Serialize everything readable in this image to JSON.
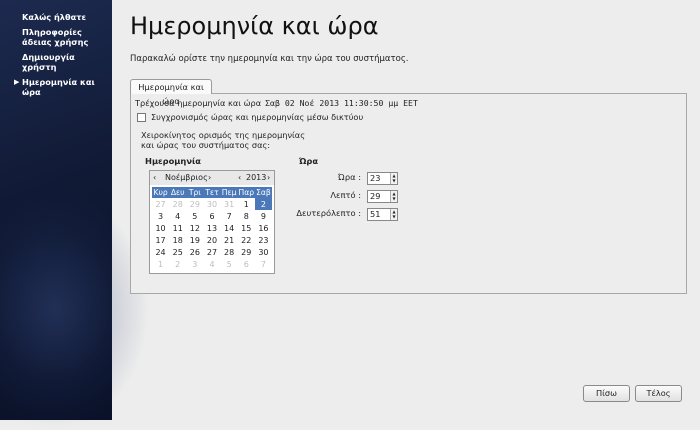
{
  "sidebar": {
    "items": [
      {
        "label": "Καλώς ήλθατε",
        "current": false
      },
      {
        "label": "Πληροφορίες\nάδειας χρήσης",
        "current": false
      },
      {
        "label": "Δημιουργία\nχρήστη",
        "current": false
      },
      {
        "label": "Ημερομηνία και\nώρα",
        "current": true
      }
    ]
  },
  "main": {
    "title": "Ημερομηνία και ώρα",
    "subtitle": "Παρακαλώ ορίστε την ημερομηνία και την ώρα του συστήματος.",
    "tab_label": "Ημερομηνία και ώρα",
    "current_label": "Τρέχουσα ημερομηνία και ώρα",
    "current_value": "Σαβ 02 Νοέ 2013 11:30:50 μμ EET",
    "ntp_label": "Συγχρονισμός ώρας και ημερομηνίας μέσω δικτύου",
    "ntp_checked": false,
    "manual_text": "Χειροκίνητος ορισμός της ημερομηνίας\nκαι ώρας του συστήματος σας:",
    "date_heading": "Ημερομηνία",
    "time_heading": "Ώρα"
  },
  "calendar": {
    "month": "Νοέμβριος",
    "year": "2013",
    "prev": "‹",
    "next": "›",
    "weekdays": [
      "Κυρ",
      "Δευ",
      "Τρι",
      "Τετ",
      "Πεμ",
      "Παρ",
      "Σαβ"
    ],
    "selected_day": "2",
    "weeks": [
      [
        "27",
        "28",
        "29",
        "30",
        "31",
        "1",
        "2"
      ],
      [
        "3",
        "4",
        "5",
        "6",
        "7",
        "8",
        "9"
      ],
      [
        "10",
        "11",
        "12",
        "13",
        "14",
        "15",
        "16"
      ],
      [
        "17",
        "18",
        "19",
        "20",
        "21",
        "22",
        "23"
      ],
      [
        "24",
        "25",
        "26",
        "27",
        "28",
        "29",
        "30"
      ],
      [
        "1",
        "2",
        "3",
        "4",
        "5",
        "6",
        "7"
      ]
    ]
  },
  "time": {
    "hour_label": "Ώρα :",
    "hour": "23",
    "minute_label": "Λεπτό :",
    "minute": "29",
    "second_label": "Δευτερόλεπτο :",
    "second": "51"
  },
  "buttons": {
    "back": "Πίσω",
    "finish": "Τέλος"
  }
}
